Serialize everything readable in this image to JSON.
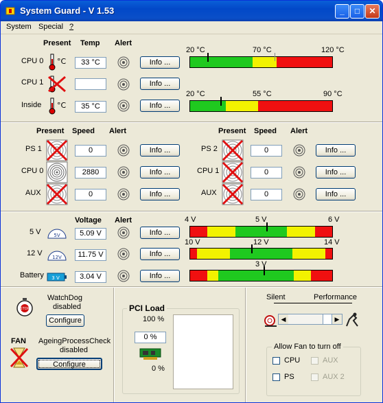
{
  "window": {
    "title": "System Guard - V 1.53"
  },
  "menu": [
    {
      "label": "System"
    },
    {
      "label": "Special"
    },
    {
      "label": "?"
    }
  ],
  "temp": {
    "headers": {
      "present": "Present",
      "temp": "Temp",
      "alert": "Alert"
    },
    "rows": [
      {
        "label": "CPU 0",
        "value": "33 °C",
        "present": true,
        "info": "Info ..."
      },
      {
        "label": "CPU 1",
        "value": "",
        "present": false,
        "info": "Info ..."
      },
      {
        "label": "Inside",
        "value": "35 °C",
        "present": true,
        "info": "Info ..."
      }
    ],
    "unit_symbol": "°C",
    "scale_cpu": {
      "min_label": "20 °C",
      "mid_label": "70 °C",
      "max_label": "120 °C",
      "value": 33,
      "threshold": 73
    },
    "scale_inside": {
      "min_label": "20 °C",
      "mid_label": "55 °C",
      "max_label": "90 °C",
      "value": 35
    }
  },
  "fans": {
    "headers": {
      "present": "Present",
      "speed": "Speed",
      "alert": "Alert"
    },
    "left": [
      {
        "label": "PS 1",
        "value": "0",
        "present": false,
        "info": "Info ..."
      },
      {
        "label": "CPU 0",
        "value": "2880",
        "present": true,
        "info": "Info ..."
      },
      {
        "label": "AUX",
        "value": "0",
        "present": false,
        "info": "Info ..."
      }
    ],
    "right": [
      {
        "label": "PS 2",
        "value": "0",
        "present": false,
        "info": "Info ..."
      },
      {
        "label": "CPU 1",
        "value": "0",
        "present": false,
        "info": "Info ..."
      },
      {
        "label": "AUX",
        "value": "0",
        "present": false,
        "info": "Info ..."
      }
    ]
  },
  "voltage": {
    "headers": {
      "voltage": "Voltage",
      "alert": "Alert"
    },
    "rows": [
      {
        "label": "5 V",
        "icon_text": "5V",
        "value": "5.09 V",
        "info": "Info ..."
      },
      {
        "label": "12 V",
        "icon_text": "12V",
        "value": "11.75 V",
        "info": "Info ..."
      },
      {
        "label": "Battery",
        "icon_text": "3 V",
        "value": "3.04 V",
        "info": "Info ..."
      }
    ],
    "scale_5v": {
      "min_label": "4 V",
      "mid_label": "5 V",
      "max_label": "6 V",
      "value": 5.09
    },
    "scale_12v": {
      "min_label": "10 V",
      "mid_label": "12 V",
      "max_label": "14 V",
      "value": 11.75
    },
    "scale_bat": {
      "mid_label": "3 V",
      "value": 3.04
    }
  },
  "bottom": {
    "watchdog": {
      "line1": "WatchDog",
      "line2": "disabled",
      "button": "Configure",
      "icon": "stopwatch-icon"
    },
    "ageing": {
      "fan_label": "FAN",
      "line1": "AgeingProcessCheck",
      "line2": "disabled",
      "button": "Configure",
      "icon": "hourglass-icon"
    },
    "pci": {
      "title": "PCI Load",
      "top": "100 %",
      "current": "0 %",
      "bottom": "0 %"
    },
    "fan_control": {
      "silent": "Silent",
      "performance": "Performance"
    },
    "allow_fan": {
      "title": "Allow Fan to turn off",
      "cpu": "CPU",
      "aux": "AUX",
      "ps": "PS",
      "aux2": "AUX 2"
    }
  },
  "colors": {
    "green": "#1fc91f",
    "yellow": "#f2f200",
    "red": "#f01010",
    "title_bar": "#0248c8"
  }
}
